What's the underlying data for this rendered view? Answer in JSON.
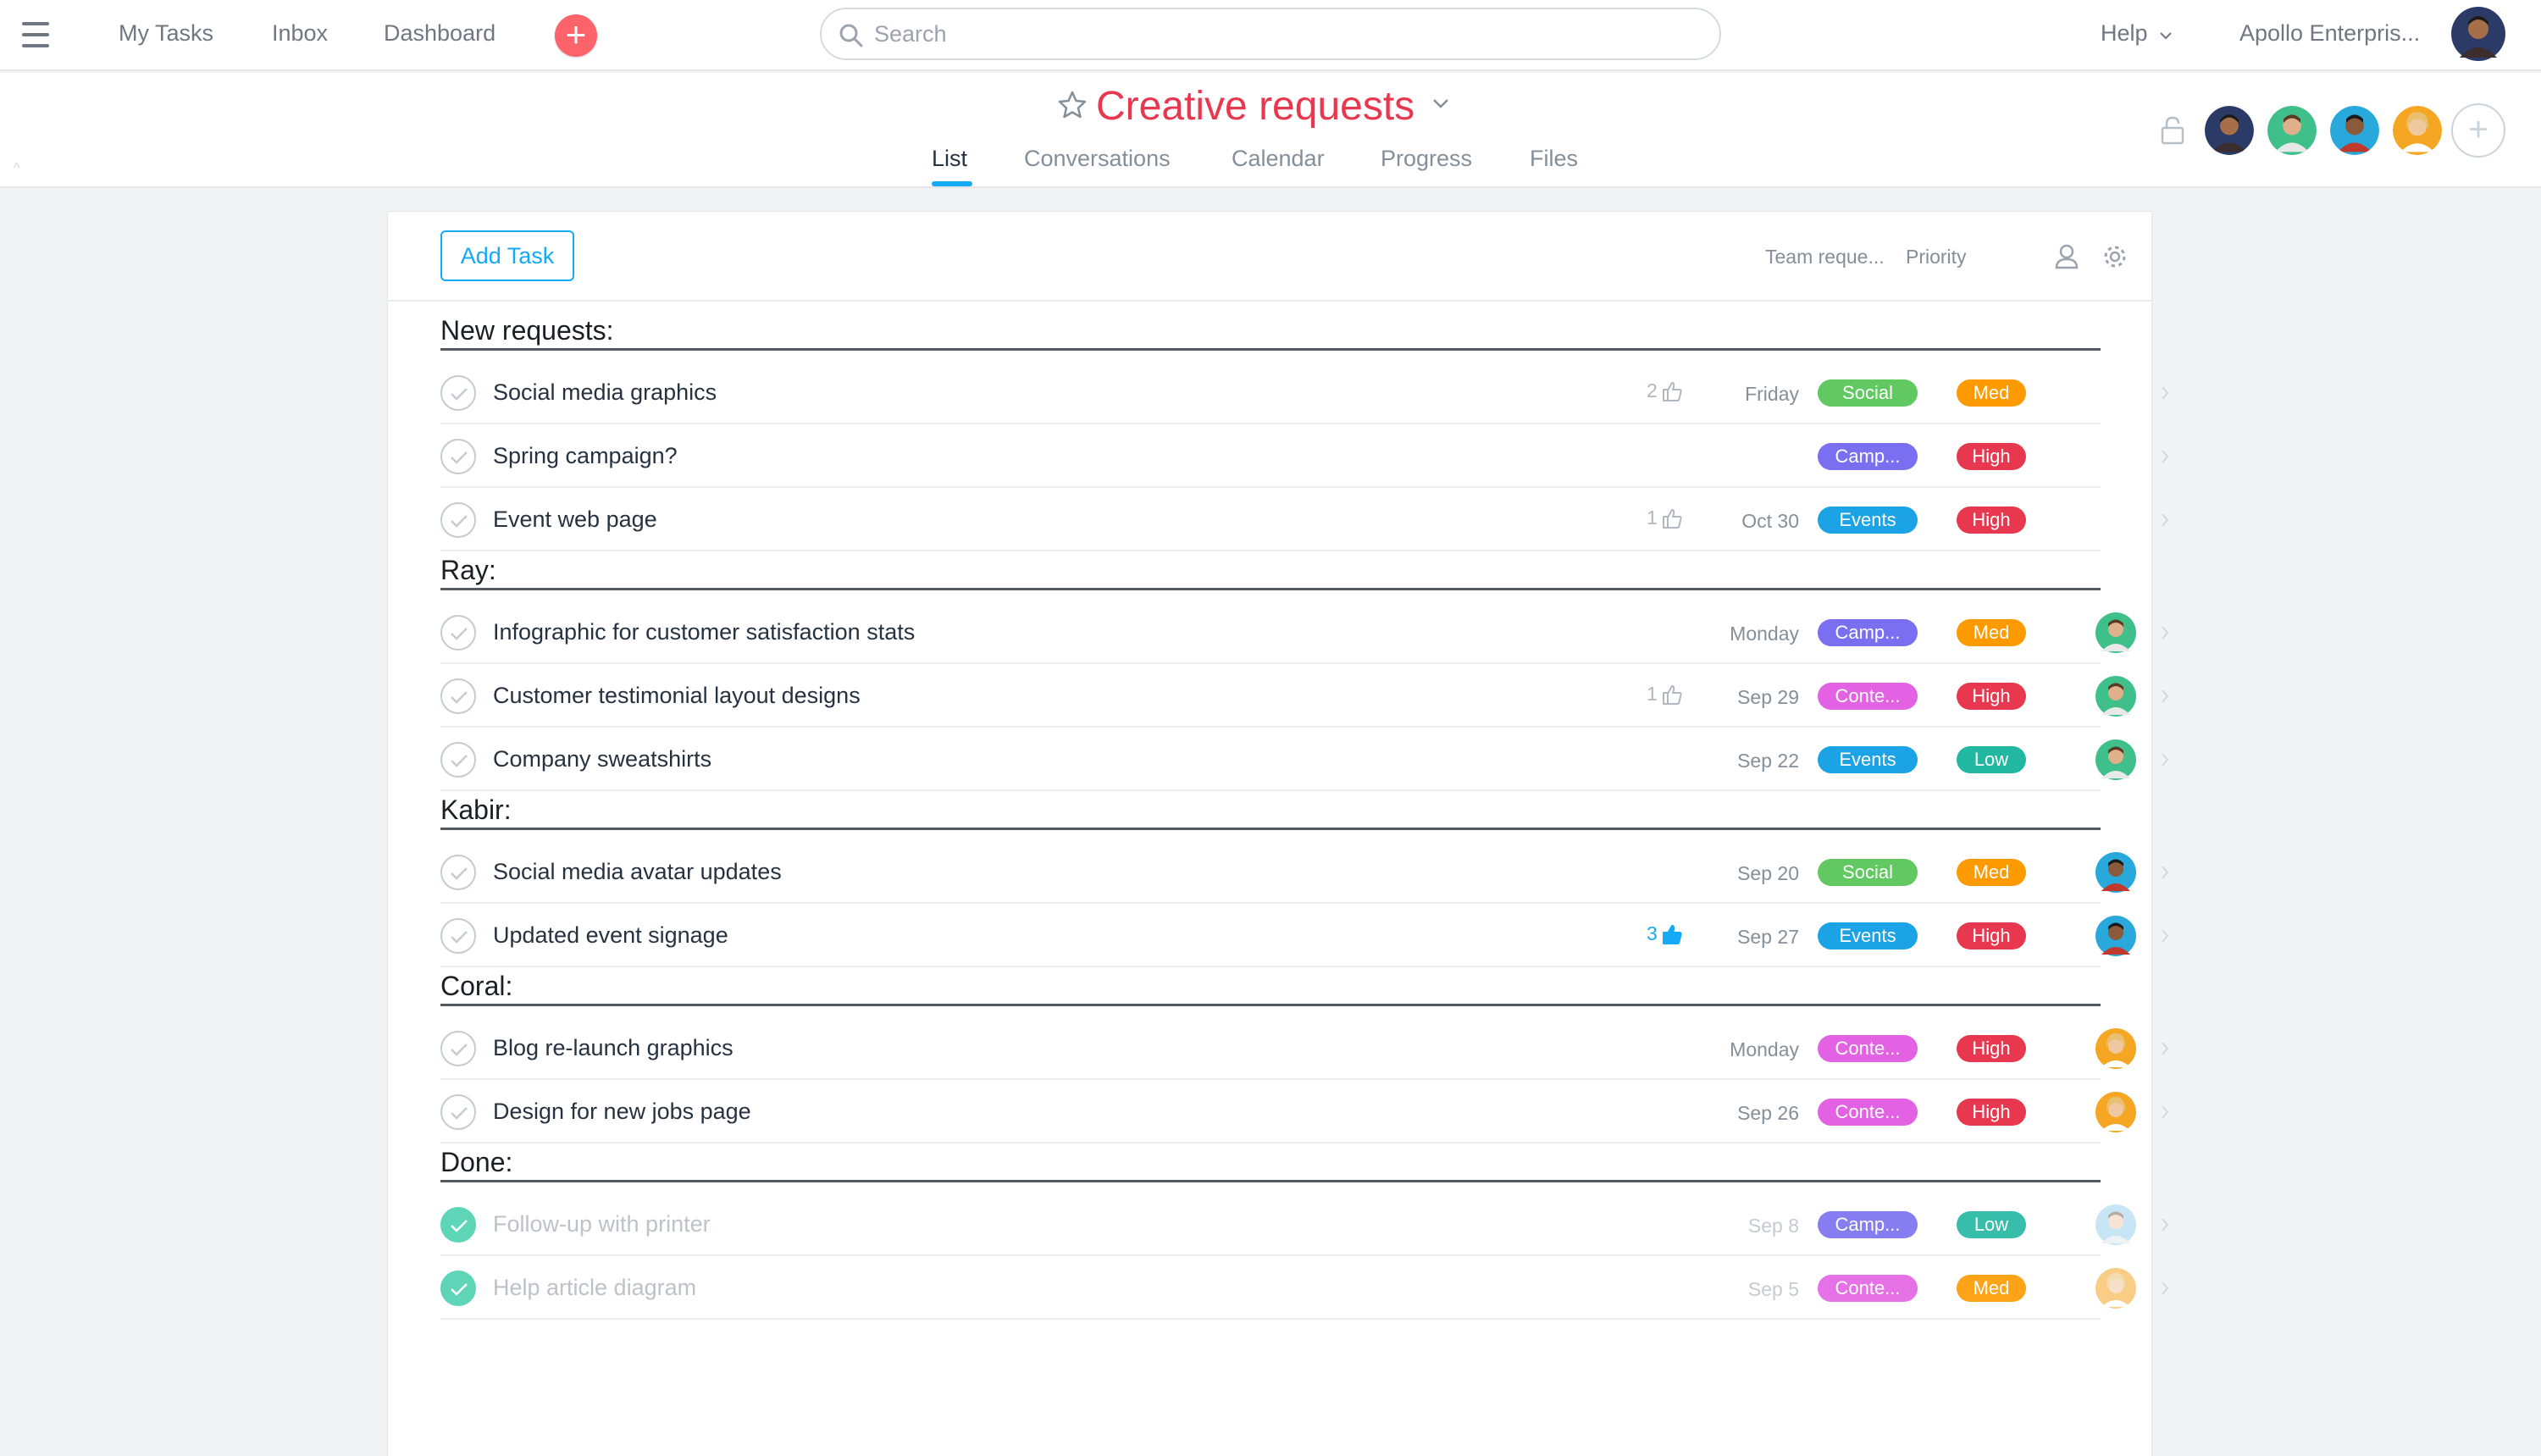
{
  "topbar": {
    "nav": [
      "My Tasks",
      "Inbox",
      "Dashboard"
    ],
    "search_placeholder": "Search",
    "help": "Help",
    "org": "Apollo Enterpris..."
  },
  "project": {
    "title": "Creative requests",
    "tabs": [
      "List",
      "Conversations",
      "Calendar",
      "Progress",
      "Files"
    ],
    "active_tab": "List"
  },
  "toolbar": {
    "add_task": "Add Task",
    "col_team": "Team reque...",
    "col_priority": "Priority"
  },
  "colors": {
    "accent": "#14aaf5",
    "title_red": "#e8384f",
    "Social": "#62c962",
    "Camp...": "#7a6ff0",
    "Events": "#1ba3e6",
    "Conte...": "#e362e3",
    "High": "#e8384f",
    "Med": "#fd9a00",
    "Low": "#22b7a1"
  },
  "sections": [
    {
      "title": "New requests:",
      "tasks": [
        {
          "name": "Social media graphics",
          "likes": "2",
          "due": "Friday",
          "team": "Social",
          "priority": "Med",
          "assignee": null
        },
        {
          "name": "Spring campaign?",
          "likes": "",
          "due": "",
          "team": "Camp...",
          "priority": "High",
          "assignee": null
        },
        {
          "name": "Event web page",
          "likes": "1",
          "due": "Oct 30",
          "team": "Events",
          "priority": "High",
          "assignee": null
        }
      ]
    },
    {
      "title": "Ray:",
      "tasks": [
        {
          "name": "Infographic for customer satisfaction stats",
          "likes": "",
          "due": "Monday",
          "team": "Camp...",
          "priority": "Med",
          "assignee": "ray"
        },
        {
          "name": "Customer testimonial layout designs",
          "likes": "1",
          "due": "Sep 29",
          "team": "Conte...",
          "priority": "High",
          "assignee": "ray"
        },
        {
          "name": "Company sweatshirts",
          "likes": "",
          "due": "Sep 22",
          "team": "Events",
          "priority": "Low",
          "assignee": "ray"
        }
      ]
    },
    {
      "title": "Kabir:",
      "tasks": [
        {
          "name": "Social media avatar updates",
          "likes": "",
          "due": "Sep 20",
          "team": "Social",
          "priority": "Med",
          "assignee": "kabir"
        },
        {
          "name": "Updated event signage",
          "likes": "3",
          "liked": true,
          "due": "Sep 27",
          "team": "Events",
          "priority": "High",
          "assignee": "kabir"
        }
      ]
    },
    {
      "title": "Coral:",
      "tasks": [
        {
          "name": "Blog re-launch graphics",
          "likes": "",
          "due": "Monday",
          "team": "Conte...",
          "priority": "High",
          "assignee": "coral"
        },
        {
          "name": "Design for new jobs page",
          "likes": "",
          "due": "Sep 26",
          "team": "Conte...",
          "priority": "High",
          "assignee": "coral"
        }
      ]
    },
    {
      "title": "Done:",
      "tasks": [
        {
          "name": "Follow-up with printer",
          "likes": "",
          "due": "Sep 8",
          "team": "Camp...",
          "priority": "Low",
          "assignee": "light",
          "done": true
        },
        {
          "name": "Help article diagram",
          "likes": "",
          "due": "Sep 5",
          "team": "Conte...",
          "priority": "Med",
          "assignee": "coral",
          "done": true
        }
      ]
    }
  ]
}
